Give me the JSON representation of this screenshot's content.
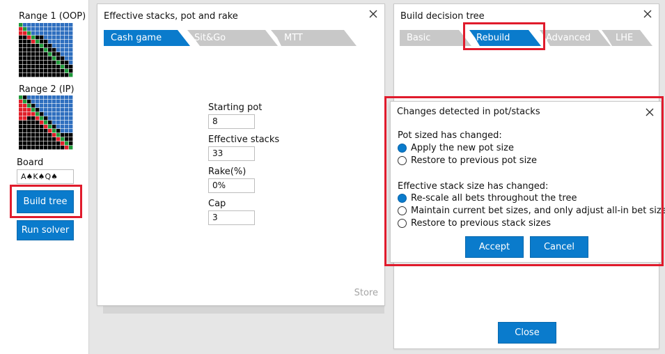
{
  "sidebar": {
    "range1_label": "Range 1 (OOP)",
    "range2_label": "Range 2 (IP)",
    "board_label": "Board",
    "board_value": "A♠K♠Q♠",
    "build_tree_label": "Build tree",
    "run_solver_label": "Run solver"
  },
  "stacks_panel": {
    "title": "Effective stacks, pot and rake",
    "tabs": [
      {
        "label": "Cash game",
        "active": true
      },
      {
        "label": "Sit&Go",
        "active": false
      },
      {
        "label": "MTT",
        "active": false
      }
    ],
    "fields": [
      {
        "label": "Starting pot",
        "value": "8"
      },
      {
        "label": "Effective stacks",
        "value": "33"
      },
      {
        "label": "Rake(%)",
        "value": "0%"
      },
      {
        "label": "Cap",
        "value": "3"
      }
    ],
    "store_label": "Store"
  },
  "tree_panel": {
    "title": "Build decision tree",
    "tabs": [
      {
        "label": "Basic",
        "active": false
      },
      {
        "label": "Rebuild",
        "active": true
      },
      {
        "label": "Advanced",
        "active": false
      },
      {
        "label": "LHE",
        "active": false
      }
    ],
    "close_label": "Close"
  },
  "modal": {
    "title": "Changes detected in pot/stacks",
    "pot_heading": "Pot sized has changed:",
    "pot_options": [
      {
        "label": "Apply the new pot size",
        "checked": true
      },
      {
        "label": "Restore to previous pot size",
        "checked": false
      }
    ],
    "stack_heading": "Effective stack size has changed:",
    "stack_options": [
      {
        "label": "Re-scale all bets throughout the tree",
        "checked": true
      },
      {
        "label": "Maintain current bet sizes, and only adjust all-in bet size",
        "checked": false
      },
      {
        "label": "Restore to previous stack sizes",
        "checked": false
      }
    ],
    "accept_label": "Accept",
    "cancel_label": "Cancel"
  },
  "colors": {
    "accent": "#0a7bcc",
    "highlight_frame": "#e01b2c",
    "inactive_tab": "#c8c8c8",
    "grid_blue": "#2f6fbf",
    "grid_red": "#e0202a",
    "grid_green": "#1f9a3a",
    "grid_black": "#000000"
  }
}
